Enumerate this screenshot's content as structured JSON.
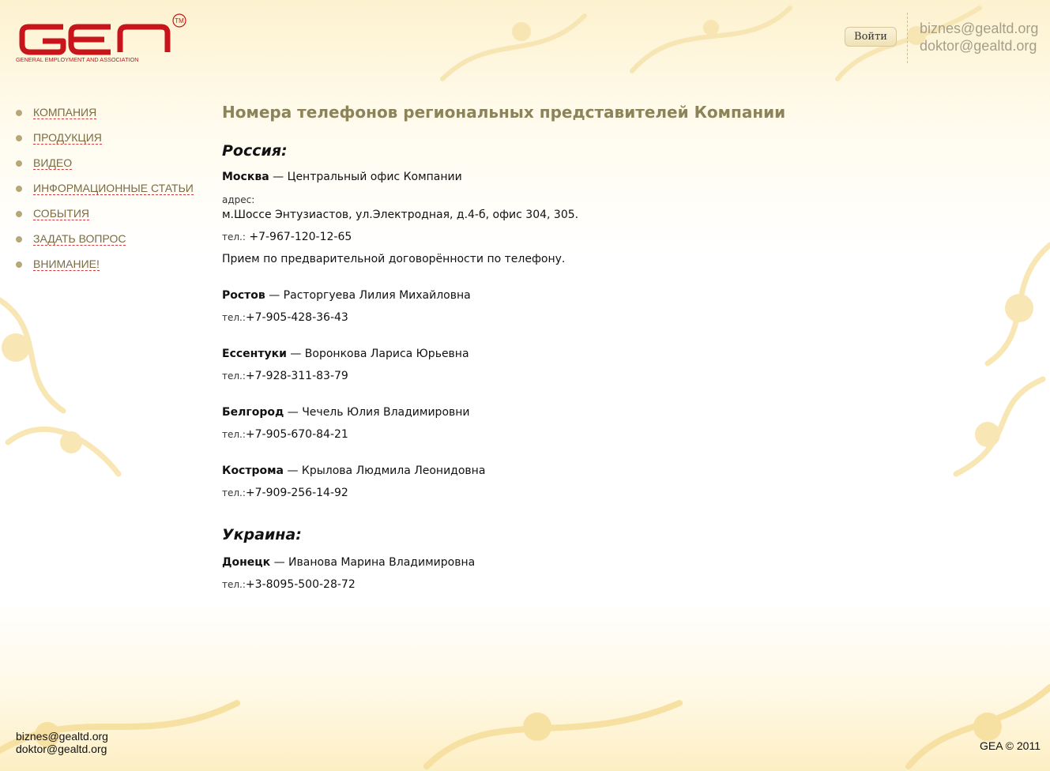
{
  "header": {
    "logo": {
      "brand": "GEA",
      "tagline": "GENERAL EMPLOYMENT AND ASSOCIATION",
      "trademark": "TM"
    },
    "login_label": "Войти",
    "emails": [
      "biznes@gealtd.org",
      "doktor@gealtd.org"
    ]
  },
  "nav": [
    {
      "label": "КОМПАНИЯ"
    },
    {
      "label": "ПРОДУКЦИЯ"
    },
    {
      "label": "ВИДЕО"
    },
    {
      "label": "ИНФОРМАЦИОННЫЕ СТАТЬИ"
    },
    {
      "label": "СОБЫТИЯ"
    },
    {
      "label": "ЗАДАТЬ ВОПРОС"
    },
    {
      "label": "ВНИМАНИЕ!"
    }
  ],
  "main": {
    "title": "Номера телефонов региональных представителей Компании",
    "countries": [
      {
        "name": "Россия:",
        "moscow": {
          "city": "Москва",
          "desc": " — Центральный офис Компании",
          "address_label": "адрес:",
          "address": "м.Шоссе Энтузиастов, ул.Электродная, д.4-б, офис 304, 305.",
          "phone_label": "тел.:",
          "phone": " +7-967-120-12-65",
          "note": "Прием по предварительной договорённости по телефону."
        },
        "regions": [
          {
            "city": "Ростов",
            "person": " — Расторгуева Лилия Михайловна",
            "phone_label": "тел.:",
            "phone": "+7-905-428-36-43"
          },
          {
            "city": "Ессентуки",
            "person": " — Воронкова Лариса Юрьевна",
            "phone_label": "тел.:",
            "phone": "+7-928-311-83-79"
          },
          {
            "city": "Белгород",
            "person": " — Чечель Юлия Владимировни",
            "phone_label": "тел.:",
            "phone": "+7-905-670-84-21"
          },
          {
            "city": "Кострома",
            "person": " — Крылова Людмила Леонидовна",
            "phone_label": "тел.:",
            "phone": "+7-909-256-14-92"
          }
        ]
      },
      {
        "name": "Украина:",
        "regions": [
          {
            "city": "Донецк",
            "person": " — Иванова Марина Владимировна",
            "phone_label": "тел.:",
            "phone": "+3-8095-500-28-72"
          }
        ]
      }
    ]
  },
  "footer": {
    "emails": [
      "biznes@gealtd.org",
      "doktor@gealtd.org"
    ],
    "copyright": "GEA © 2011"
  },
  "colors": {
    "accent": "#8c8358",
    "nav_text": "#7a6b43",
    "nav_underline": "#d23b3b",
    "logo_red": "#c8141b",
    "ornament": "#f6e3a8"
  }
}
